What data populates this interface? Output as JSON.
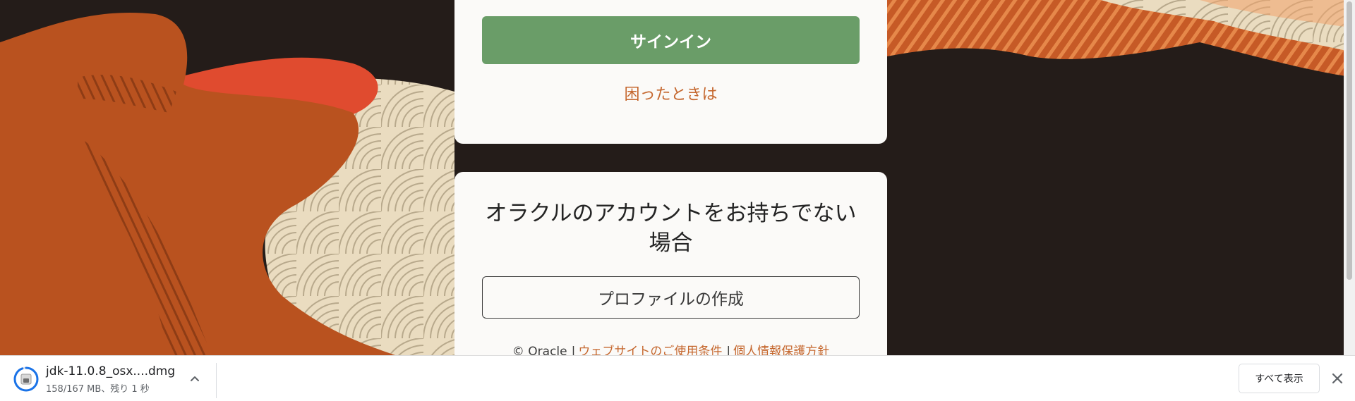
{
  "signin": {
    "button_label": "サインイン",
    "help_link": "困ったときは"
  },
  "signup": {
    "title": "オラクルのアカウントをお持ちでない場合",
    "create_profile_label": "プロファイルの作成"
  },
  "footer": {
    "copyright": "© Oracle",
    "separator": "|",
    "terms_link": "ウェブサイトのご使用条件",
    "privacy_link": "個人情報保護方針"
  },
  "download_bar": {
    "filename": "jdk-11.0.8_osx....dmg",
    "status": "158/167 MB、残り 1 秒",
    "progress": 0.946,
    "show_all_label": "すべて表示",
    "icons": [
      "disk-image-icon",
      "chevron-up-icon",
      "close-icon"
    ]
  },
  "colors": {
    "signin_button": "#6a9d68",
    "link": "#c5672e",
    "card_background": "#fbfaf8",
    "page_background": "#241c19"
  }
}
